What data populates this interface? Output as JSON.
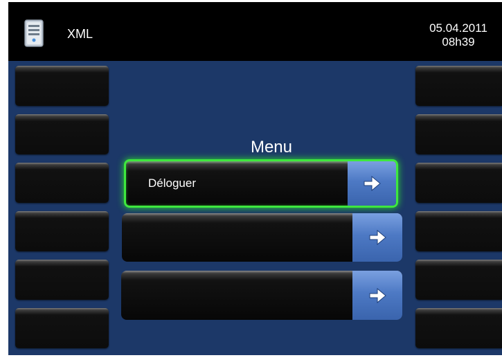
{
  "header": {
    "app_icon": "server-icon",
    "title": "XML",
    "date": "05.04.2011",
    "time": "08h39"
  },
  "menu": {
    "title": "Menu",
    "items": [
      {
        "label": "Déloguer",
        "selected": true
      },
      {
        "label": "",
        "selected": false
      },
      {
        "label": "",
        "selected": false
      }
    ],
    "arrow_icon": "arrow-right-icon"
  },
  "colors": {
    "background": "#1c3868",
    "header": "#000000",
    "selection_glow": "#3ee83e",
    "arrow_button": "#4d79c4"
  }
}
